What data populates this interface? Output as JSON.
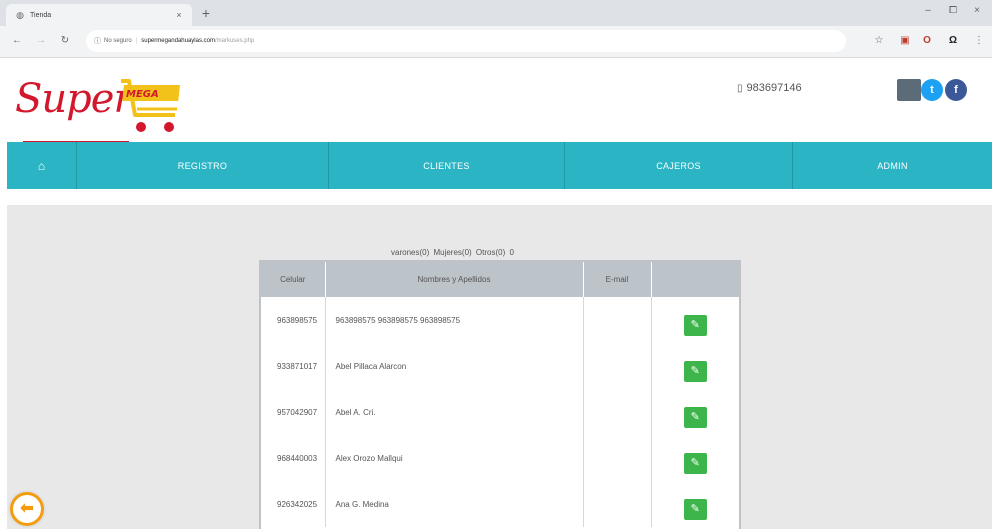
{
  "browser": {
    "tab_title": "Tienda",
    "tab_close": "×",
    "new_tab": "+",
    "security_label": "No seguro",
    "url_host": "supermegandahuaylas.com",
    "url_path": "/markuses.php",
    "window_controls": [
      "–",
      "⧠",
      "×"
    ]
  },
  "header": {
    "logo_super": "Super",
    "logo_mega": "MEGA",
    "phone": "983697146"
  },
  "nav": {
    "items": [
      "REGISTRO",
      "CLIENTES",
      "CAJEROS",
      "ADMIN"
    ]
  },
  "summary": {
    "text": "varones(0)  Mujeres(0)  Otros(0)   0"
  },
  "table": {
    "headers": [
      "Celular",
      "Nombres y Apellidos",
      "E-mail",
      ""
    ],
    "rows": [
      {
        "celular": "963898575",
        "nombre": "963898575 963898575 963898575",
        "email": ""
      },
      {
        "celular": "933871017",
        "nombre": "Abel Pillaca Alarcon",
        "email": ""
      },
      {
        "celular": "957042907",
        "nombre": "Abel A. Cri.",
        "email": ""
      },
      {
        "celular": "968440003",
        "nombre": "Alex Orozo Mallqui",
        "email": ""
      },
      {
        "celular": "926342025",
        "nombre": "Ana G. Medina",
        "email": ""
      }
    ]
  },
  "colors": {
    "nav_bg": "#2bb5c4",
    "brand_red": "#d3172d",
    "edit_green": "#3eb54b",
    "back_orange": "#f39c12"
  }
}
